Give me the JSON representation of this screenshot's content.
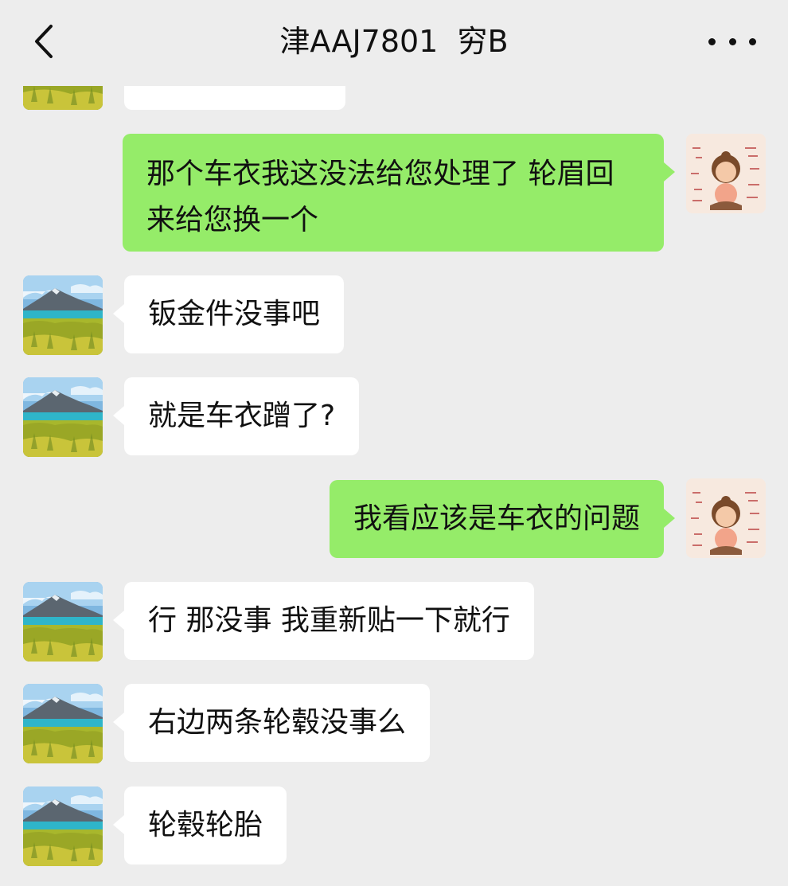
{
  "header": {
    "title": "津AAJ7801  穷B",
    "back_icon": "chevron-left-icon",
    "more_icon": "ellipsis-icon"
  },
  "colors": {
    "background": "#ededed",
    "incoming_bubble": "#ffffff",
    "outgoing_bubble": "#95ec69"
  },
  "messages": [
    {
      "from": "contact",
      "text": ""
    },
    {
      "from": "me",
      "text": "那个车衣我这没法给您处理了   轮眉回来给您换一个"
    },
    {
      "from": "contact",
      "text": "钣金件没事吧"
    },
    {
      "from": "contact",
      "text": "就是车衣蹭了?"
    },
    {
      "from": "me",
      "text": "我看应该是车衣的问题"
    },
    {
      "from": "contact",
      "text": "行 那没事 我重新贴一下就行"
    },
    {
      "from": "contact",
      "text": "右边两条轮毂没事么"
    },
    {
      "from": "contact",
      "text": "轮毂轮胎"
    }
  ]
}
